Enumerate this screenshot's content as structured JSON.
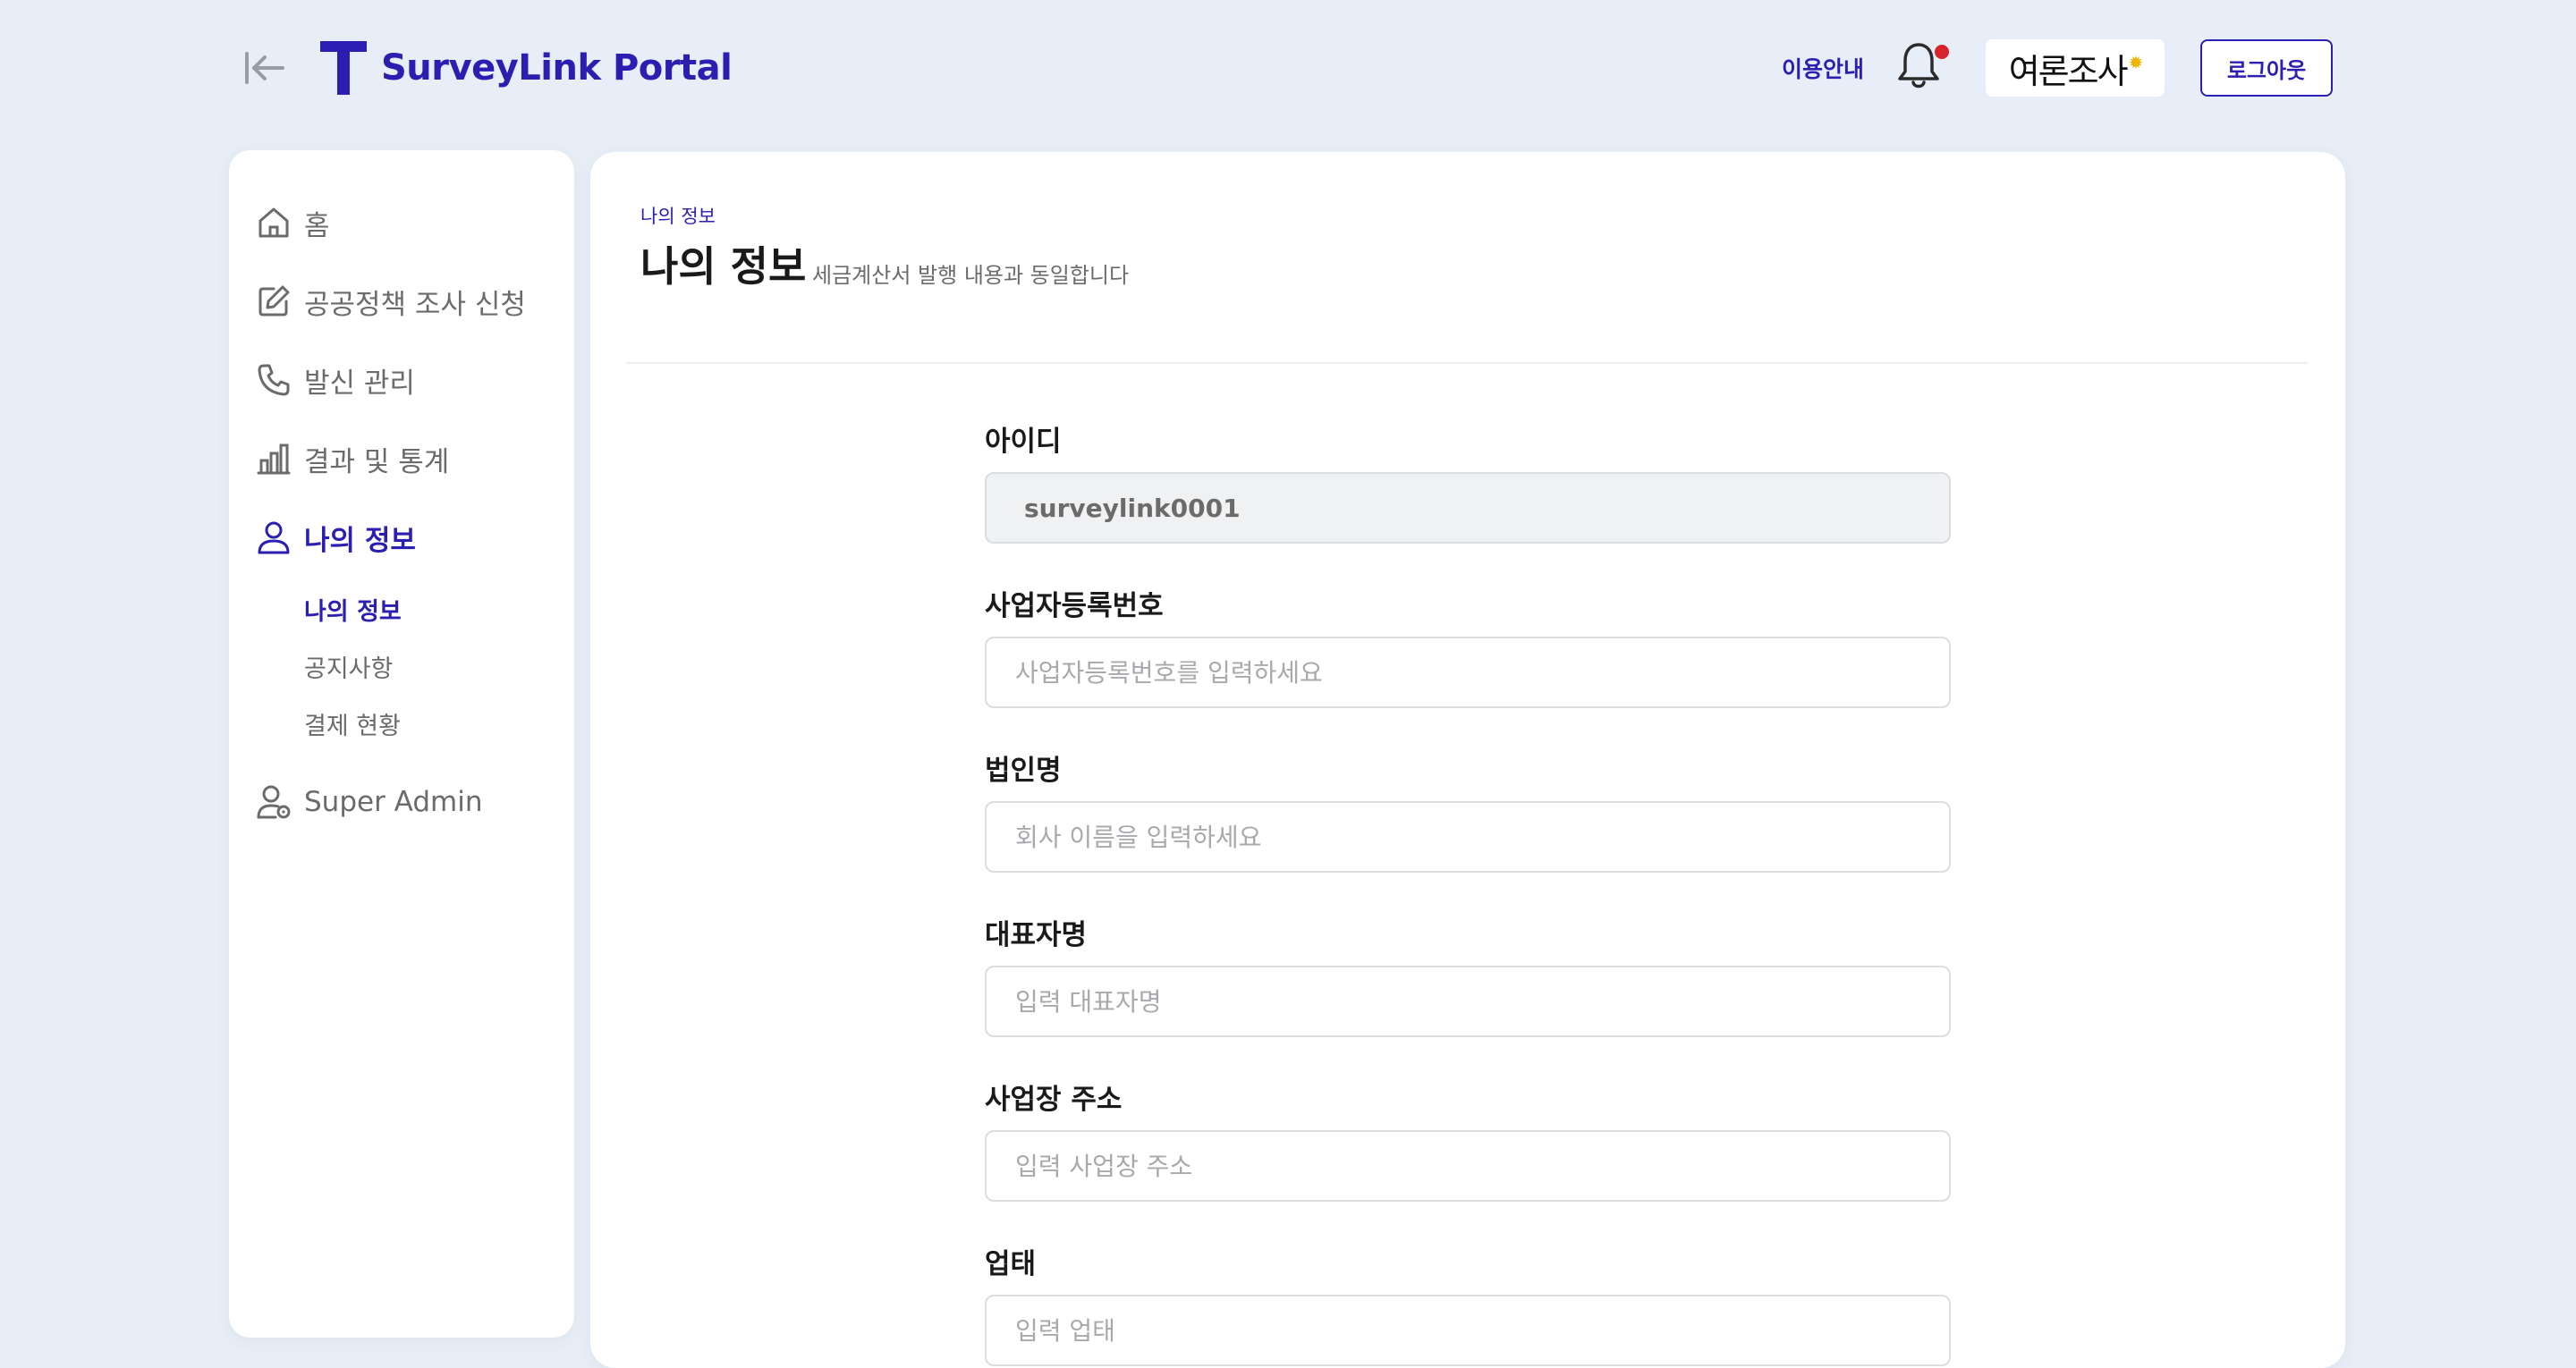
{
  "header": {
    "brand_name": "SurveyLink Portal",
    "guide_link": "이용안내",
    "partner_logo_text": "여론조사",
    "logout_label": "로그아웃"
  },
  "sidebar": {
    "items": [
      {
        "label": "홈",
        "icon": "home-icon"
      },
      {
        "label": "공공정책 조사 신청",
        "icon": "edit-icon"
      },
      {
        "label": "발신 관리",
        "icon": "phone-icon"
      },
      {
        "label": "결과 및 통계",
        "icon": "bar-chart-icon"
      },
      {
        "label": "나의 정보",
        "icon": "user-icon",
        "active": true
      },
      {
        "label": "Super Admin",
        "icon": "admin-user-icon"
      }
    ],
    "sub_items": [
      {
        "label": "나의 정보",
        "active": true
      },
      {
        "label": "공지사항"
      },
      {
        "label": "결제 현황"
      }
    ]
  },
  "page": {
    "breadcrumb": "나의 정보",
    "title": "나의 정보",
    "subtitle": "세금계산서 발행 내용과 동일합니다"
  },
  "form": {
    "fields": [
      {
        "label": "아이디",
        "value": "surveylink0001",
        "placeholder": "",
        "readonly": true
      },
      {
        "label": "사업자등록번호",
        "value": "",
        "placeholder": "사업자등록번호를 입력하세요"
      },
      {
        "label": "법인명",
        "value": "",
        "placeholder": "회사 이름을 입력하세요"
      },
      {
        "label": "대표자명",
        "value": "",
        "placeholder": "입력 대표자명"
      },
      {
        "label": "사업장 주소",
        "value": "",
        "placeholder": "입력 사업장 주소"
      },
      {
        "label": "업태",
        "value": "",
        "placeholder": "입력 업태"
      }
    ]
  },
  "colors": {
    "accent": "#2a1fb0",
    "background": "#e8eef7",
    "notification_dot": "#d9232a"
  }
}
